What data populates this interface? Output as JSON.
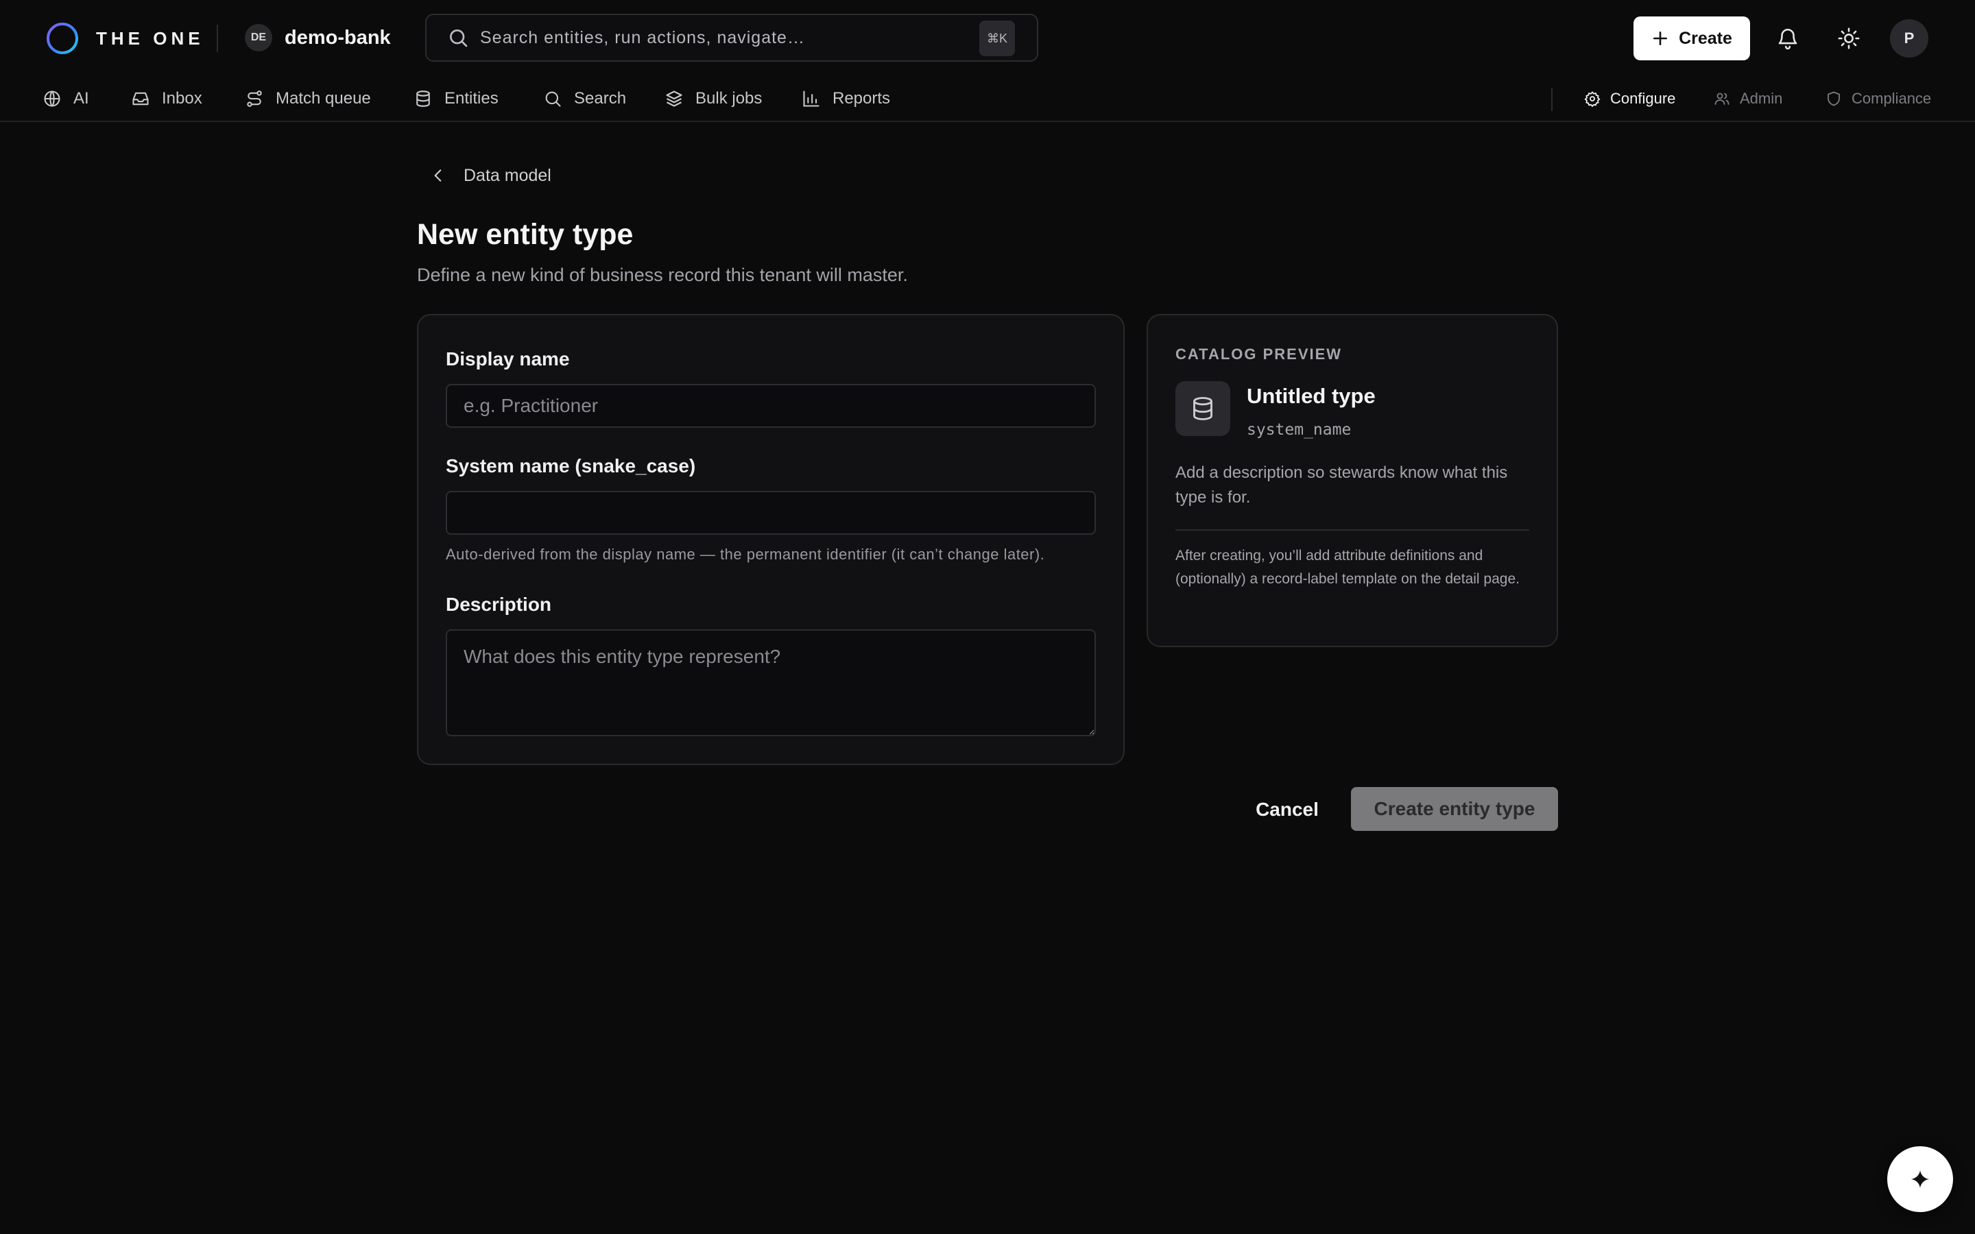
{
  "app": {
    "brand_name": "THE ONE",
    "tenant_badge": "DE",
    "tenant_name": "demo-bank"
  },
  "search": {
    "placeholder": "Search entities, run actions, navigate…",
    "shortcut": "⌘K"
  },
  "header": {
    "create_label": "Create",
    "avatar_initial": "P"
  },
  "nav": {
    "items": [
      {
        "label": "AI",
        "icon": "globe-icon"
      },
      {
        "label": "Inbox",
        "icon": "inbox-icon"
      },
      {
        "label": "Match queue",
        "icon": "route-icon"
      },
      {
        "label": "Entities",
        "icon": "database-icon"
      },
      {
        "label": "Search",
        "icon": "search-icon"
      },
      {
        "label": "Bulk jobs",
        "icon": "layers-icon"
      },
      {
        "label": "Reports",
        "icon": "bar-chart-icon"
      }
    ],
    "right_items": [
      {
        "label": "Configure",
        "icon": "gear-icon",
        "state": "active"
      },
      {
        "label": "Admin",
        "icon": "users-icon",
        "state": "dim"
      },
      {
        "label": "Compliance",
        "icon": "shield-icon",
        "state": "dim"
      }
    ]
  },
  "page": {
    "back_label": "Data model",
    "title": "New entity type",
    "subtitle": "Define a new kind of business record this tenant will master."
  },
  "form": {
    "display_name_label": "Display name",
    "display_name_placeholder": "e.g. Practitioner",
    "display_name_value": "",
    "system_name_label": "System name (snake_case)",
    "system_name_placeholder": "",
    "system_name_value": "",
    "system_name_hint": "Auto-derived from the display name — the permanent identifier (it can’t change later).",
    "description_label": "Description",
    "description_placeholder": "What does this entity type represent?",
    "description_value": ""
  },
  "preview": {
    "eyebrow": "CATALOG PREVIEW",
    "icon": "database-icon",
    "name": "Untitled type",
    "system_name": "system_name",
    "description": "Add a description so stewards know what this type is for.",
    "note": "After creating, you’ll add attribute definitions and (optionally) a record-label template on the detail page."
  },
  "actions": {
    "cancel_label": "Cancel",
    "submit_label": "Create entity type",
    "submit_disabled": true
  },
  "colors": {
    "background": "#0b0b0c",
    "card": "#111113",
    "primary_button": "#ffffff",
    "disabled_button": "#7a7a7d"
  }
}
